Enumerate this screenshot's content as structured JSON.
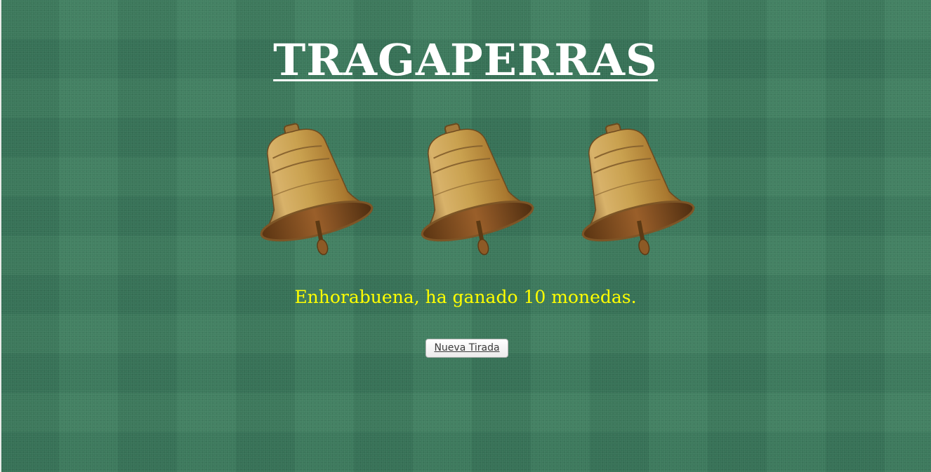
{
  "game": {
    "title": "TRAGAPERRAS",
    "result_message": "Enhorabuena, ha ganado 10 monedas.",
    "spin_button_label": "Nueva Tirada"
  },
  "reels": [
    {
      "symbol": "bell-icon"
    },
    {
      "symbol": "bell-icon"
    },
    {
      "symbol": "bell-icon"
    }
  ],
  "colors": {
    "background": "#3a7a5c",
    "title": "#ffffff",
    "message": "#ffff00",
    "bell_gold": "#c9a14f"
  }
}
